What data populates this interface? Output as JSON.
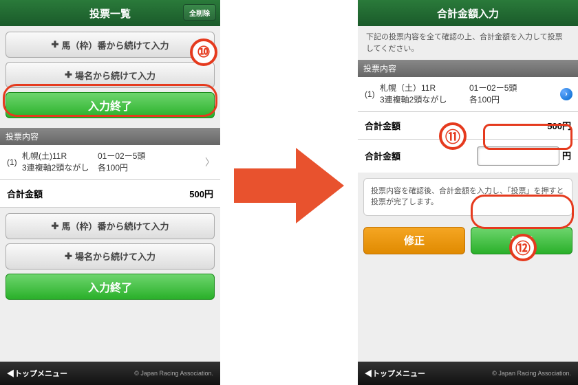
{
  "left": {
    "header": {
      "title": "投票一覧",
      "clear_btn": "全削除"
    },
    "buttons": {
      "continue_horse": "馬（枠）番から続けて入力",
      "continue_venue": "場名から続けて入力",
      "finish": "入力終了"
    },
    "section_label": "投票内容",
    "bet": {
      "num": "(1)",
      "race_line1": "札幌(土)11R",
      "race_line2": "3連複軸2頭ながし",
      "sel_line1": "01ー02ー5頭",
      "sel_line2": "各100円"
    },
    "total": {
      "label": "合計金額",
      "value": "500円"
    }
  },
  "right": {
    "header": {
      "title": "合計金額入力"
    },
    "instruction": "下記の投票内容を全て確認の上、合計金額を入力して投票してください。",
    "section_label": "投票内容",
    "bet": {
      "num": "(1)",
      "race_line1": "札幌（土）11R",
      "race_line2": "3連複軸2頭ながし",
      "sel_line1": "01ー02ー5頭",
      "sel_line2": "各100円"
    },
    "total": {
      "label": "合計金額",
      "value": "500円"
    },
    "input": {
      "label": "合計金額",
      "unit": "円"
    },
    "note": "投票内容を確認後、合計金額を入力し、「投票」を押すと投票が完了します。",
    "buttons": {
      "edit": "修正",
      "submit": "投票"
    }
  },
  "footer": {
    "left": "トップメニュー",
    "right": "© Japan Racing Association."
  },
  "callouts": {
    "n10": "⑩",
    "n11": "⑪",
    "n12": "⑫"
  }
}
